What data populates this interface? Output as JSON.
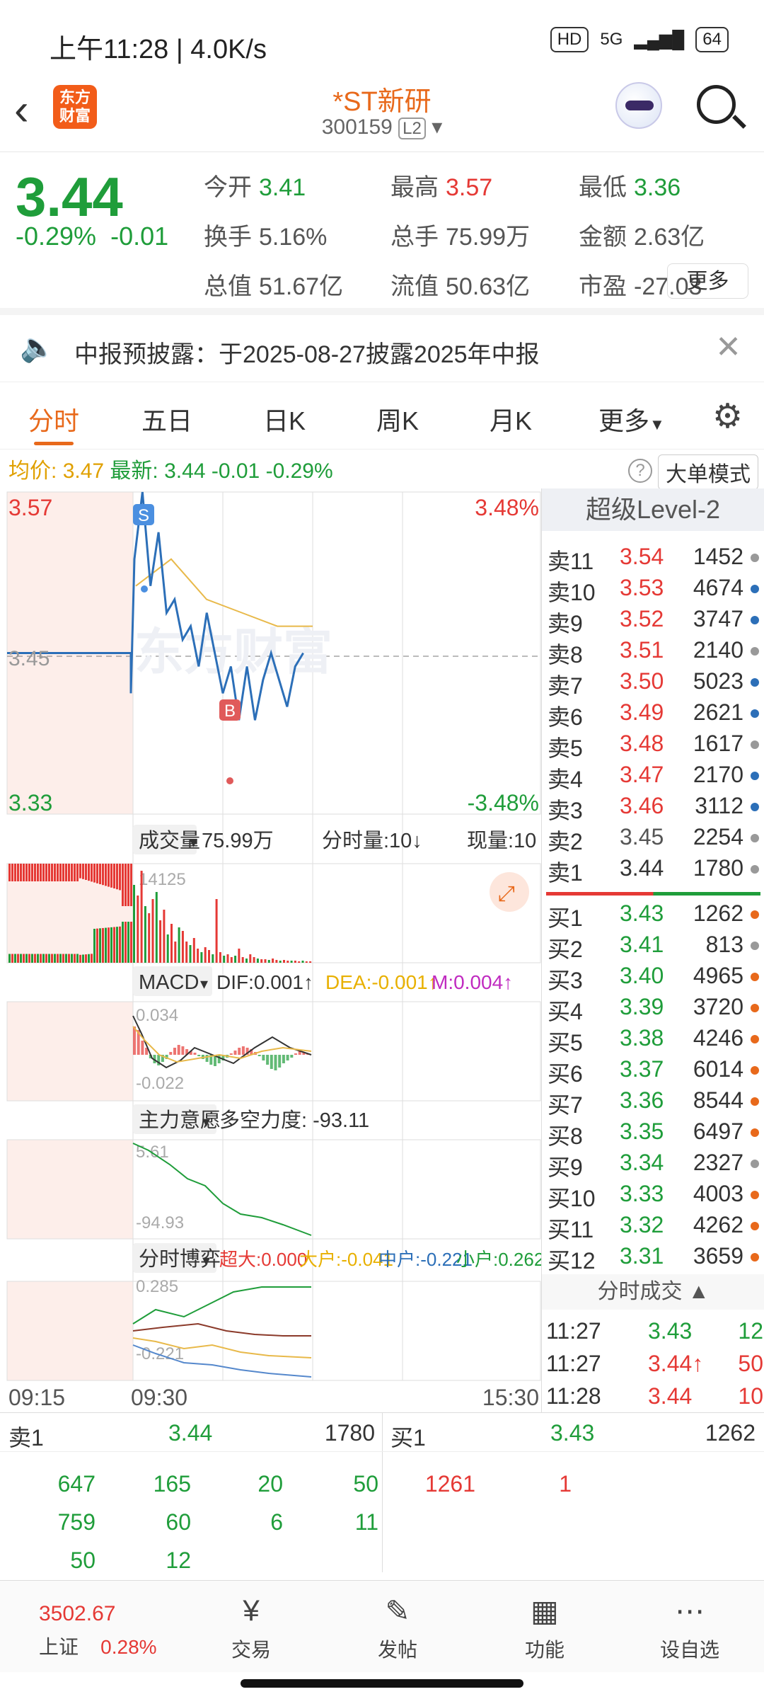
{
  "status": {
    "time": "上午11:28 | 4.0K/s",
    "network": "5G",
    "battery": "64",
    "hd": "HD"
  },
  "header": {
    "title": "*ST新研",
    "code": "300159",
    "level": "L2",
    "logo": "东方\n财富"
  },
  "quote": {
    "price": "3.44",
    "pct": "-0.29%",
    "chg": "-0.01",
    "rows": [
      [
        {
          "k": "今开",
          "v": "3.41",
          "c": "down"
        },
        {
          "k": "最高",
          "v": "3.57",
          "c": "up"
        },
        {
          "k": "最低",
          "v": "3.36",
          "c": "down"
        }
      ],
      [
        {
          "k": "换手",
          "v": "5.16%",
          "c": "gray"
        },
        {
          "k": "总手",
          "v": "75.99万",
          "c": "gray"
        },
        {
          "k": "金额",
          "v": "2.63亿",
          "c": "gray"
        }
      ],
      [
        {
          "k": "总值",
          "v": "51.67亿",
          "c": "gray"
        },
        {
          "k": "流值",
          "v": "50.63亿",
          "c": "gray"
        },
        {
          "k": "市盈",
          "v": "-27.03",
          "c": "gray"
        }
      ]
    ],
    "more": "更多"
  },
  "notice": "中报预披露：于2025-08-27披露2025年中报",
  "tabs": [
    "分时",
    "五日",
    "日K",
    "周K",
    "月K",
    "更多"
  ],
  "avgline": {
    "avg_label": "均价:",
    "avg": "3.47",
    "last_label": "最新:",
    "last": "3.44",
    "chg": "-0.01",
    "pct": "-0.29%",
    "mode": "大单模式"
  },
  "chart": {
    "ymax": "3.57",
    "ymid": "3.45",
    "ymin": "3.33",
    "pmax": "3.48%",
    "pmin": "-3.48%",
    "vol_label": "成交量",
    "vol": "75.99万",
    "vol_period": "分时量:10↓",
    "vol_now": "现量:10",
    "vol_max": "14125",
    "macd_label": "MACD",
    "dif": "DIF:0.001↑",
    "dea": "DEA:-0.001↑",
    "m": "M:0.004↑",
    "macd_top": "0.034",
    "macd_bot": "-0.022",
    "zl_label": "主力意愿",
    "zl": "多空力度: -93.11",
    "zl_top": "5.61",
    "zl_bot": "-94.93",
    "bo_label": "分时博弈",
    "cd": "超大:0.000",
    "dh": "大户:-0.041",
    "zh": "中户:-0.221",
    "xh": "小户:0.262",
    "bo_top": "0.285",
    "bo_bot": "-0.221",
    "t0": "09:15",
    "t1": "09:30",
    "t2": "15:30",
    "watermark": "东方财富",
    "s_marker": "S",
    "b_marker": "B"
  },
  "chart_data": {
    "type": "line",
    "title": "",
    "x": [
      "09:15",
      "09:30",
      "15:30"
    ],
    "ylim": [
      3.33,
      3.57
    ],
    "series": [
      {
        "name": "",
        "values": [
          3.45,
          3.45,
          3.42,
          3.52,
          3.57,
          3.5,
          3.54,
          3.48,
          3.49,
          3.46,
          3.47,
          3.44,
          3.48,
          3.45,
          3.42,
          3.44,
          3.4,
          3.44,
          3.4,
          3.43,
          3.45,
          3.43,
          3.41,
          3.44,
          3.45
        ]
      },
      {
        "name": "均价",
        "values": [
          3.5,
          3.52,
          3.49,
          3.48,
          3.47,
          3.47
        ]
      }
    ]
  },
  "level2": {
    "title": "超级Level-2",
    "asks": [
      [
        "卖11",
        "3.54",
        "1452"
      ],
      [
        "卖10",
        "3.53",
        "4674"
      ],
      [
        "卖9",
        "3.52",
        "3747"
      ],
      [
        "卖8",
        "3.51",
        "2140"
      ],
      [
        "卖7",
        "3.50",
        "5023"
      ],
      [
        "卖6",
        "3.49",
        "2621"
      ],
      [
        "卖5",
        "3.48",
        "1617"
      ],
      [
        "卖4",
        "3.47",
        "2170"
      ],
      [
        "卖3",
        "3.46",
        "3112"
      ],
      [
        "卖2",
        "3.45",
        "2254"
      ],
      [
        "卖1",
        "3.44",
        "1780"
      ]
    ],
    "bids": [
      [
        "买1",
        "3.43",
        "1262"
      ],
      [
        "买2",
        "3.41",
        "813"
      ],
      [
        "买3",
        "3.40",
        "4965"
      ],
      [
        "买4",
        "3.39",
        "3720"
      ],
      [
        "买5",
        "3.38",
        "4246"
      ],
      [
        "买6",
        "3.37",
        "6014"
      ],
      [
        "买7",
        "3.36",
        "8544"
      ],
      [
        "买8",
        "3.35",
        "6497"
      ],
      [
        "买9",
        "3.34",
        "2327"
      ],
      [
        "买10",
        "3.33",
        "4003"
      ],
      [
        "买11",
        "3.32",
        "4262"
      ],
      [
        "买12",
        "3.31",
        "3659"
      ]
    ],
    "trades_title": "分时成交",
    "trades": [
      [
        "11:27",
        "3.43",
        "12"
      ],
      [
        "11:27",
        "3.44↑",
        "50"
      ],
      [
        "11:28",
        "3.44",
        "10"
      ]
    ]
  },
  "depth": {
    "sell_label": "卖1",
    "sell_price": "3.44",
    "sell_vol": "1780",
    "buy_label": "买1",
    "buy_price": "3.43",
    "buy_vol": "1262",
    "sell_rows": [
      [
        "647",
        "165",
        "20",
        "50"
      ],
      [
        "759",
        "60",
        "6",
        "11"
      ],
      [
        "50",
        "12",
        "",
        ""
      ]
    ],
    "buy_rows": [
      [
        "1261",
        "1"
      ]
    ]
  },
  "nav": {
    "index_val": "3502.67",
    "index_name": "上证",
    "index_pct": "0.28%",
    "items": [
      "交易",
      "发帖",
      "功能",
      "设自选"
    ]
  }
}
